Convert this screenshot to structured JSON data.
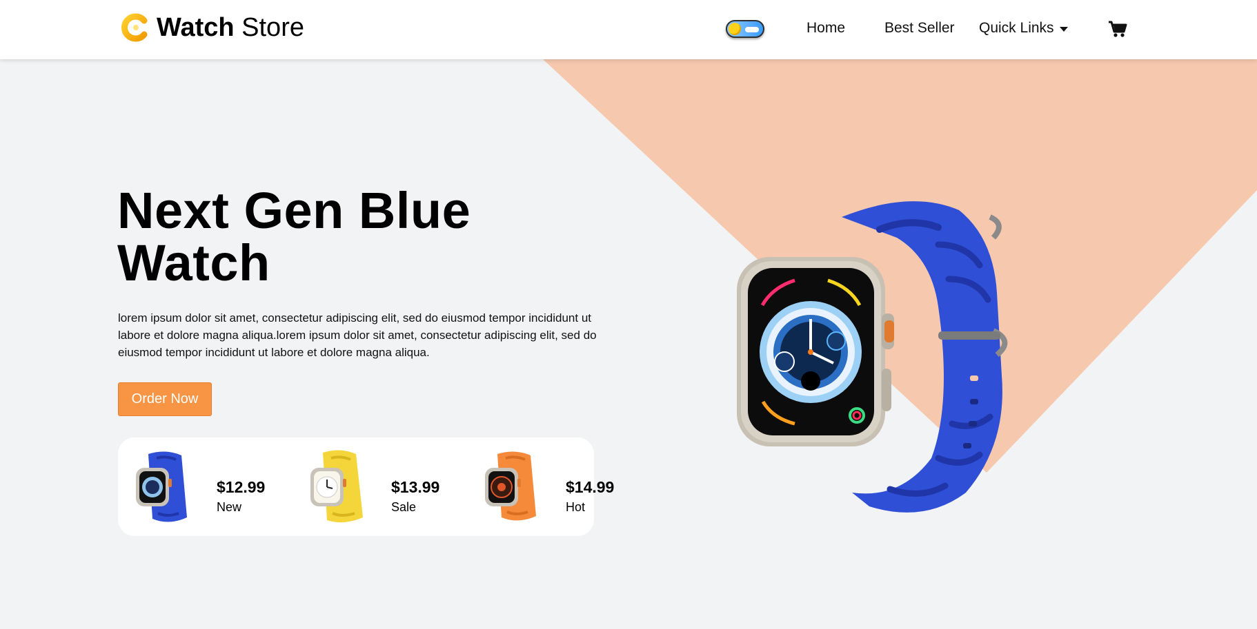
{
  "header": {
    "brand_bold": "Watch",
    "brand_light": "Store",
    "nav": {
      "home": "Home",
      "best_seller": "Best Seller",
      "quick_links": "Quick Links"
    },
    "theme_toggle_icon": "sun-toggle-icon",
    "cart_icon": "cart-icon"
  },
  "hero": {
    "title": "Next Gen Blue Watch",
    "description": "lorem ipsum dolor sit amet, consectetur adipiscing elit, sed do eiusmod tempor incididunt ut labore et dolore magna aliqua.lorem ipsum dolor sit amet, consectetur adipiscing elit, sed do eiusmod tempor incididunt ut labore et dolore magna aliqua.",
    "button_label": "Order Now"
  },
  "products": [
    {
      "price": "$12.99",
      "tag": "New",
      "band_color": "#2f4fd6"
    },
    {
      "price": "$13.99",
      "tag": "Sale",
      "band_color": "#f4d63a"
    },
    {
      "price": "$14.99",
      "tag": "Hot",
      "band_color": "#f58a3a"
    }
  ],
  "colors": {
    "accent": "#f79545",
    "peach": "#f6c8ae",
    "background": "#f2f3f5",
    "logo": "#f5b400"
  }
}
